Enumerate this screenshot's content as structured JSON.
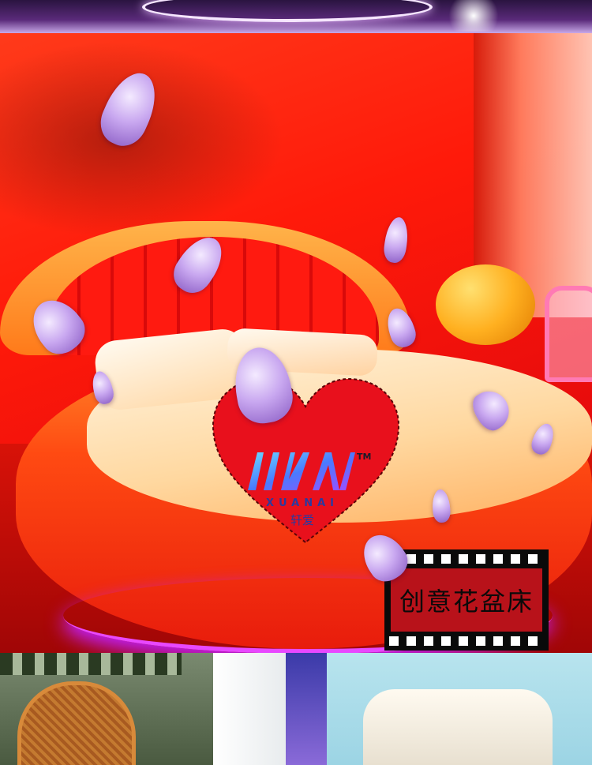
{
  "logo": {
    "brand_latin": "XUANAI",
    "brand_cn": "轩爱",
    "trademark": "TM"
  },
  "stamp": {
    "text": "创意花盆床"
  },
  "colors": {
    "wall_red": "#ff2a10",
    "heart_red": "#e8101c",
    "bed_orange": "#ff9a2a",
    "led_purple": "#d030ff",
    "petal_lilac": "#c9a8f0"
  }
}
